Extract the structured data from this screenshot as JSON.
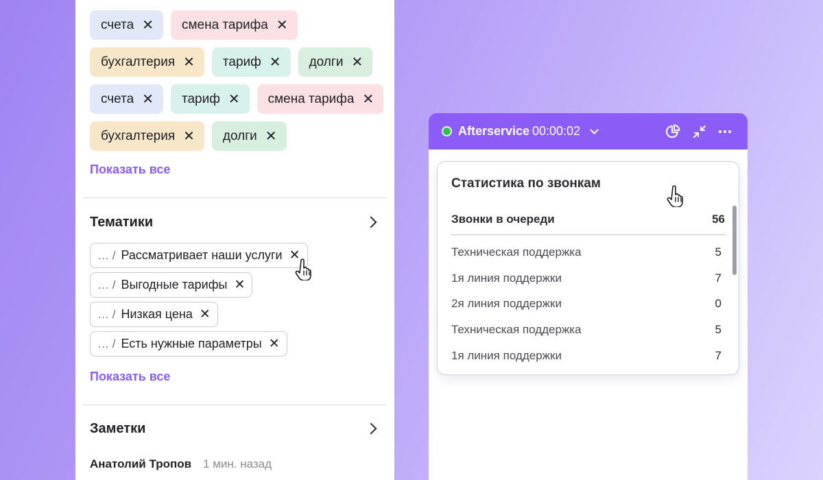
{
  "tags": {
    "rows": [
      [
        {
          "label": "счета",
          "color": "#e1e9f8"
        },
        {
          "label": "смена тарифа",
          "color": "#fbe1e4"
        }
      ],
      [
        {
          "label": "бухгалтерия",
          "color": "#f8e6c8"
        },
        {
          "label": "тариф",
          "color": "#d8f1ec"
        },
        {
          "label": "долги",
          "color": "#d8efdf"
        }
      ],
      [
        {
          "label": "счета",
          "color": "#e1e9f8"
        },
        {
          "label": "тариф",
          "color": "#d8f1ec"
        },
        {
          "label": "смена тарифа",
          "color": "#fbe1e4"
        }
      ],
      [
        {
          "label": "бухгалтерия",
          "color": "#f8e6c8"
        },
        {
          "label": "долги",
          "color": "#d8efdf"
        }
      ]
    ],
    "remove_glyph": "✕",
    "show_all": "Показать все"
  },
  "topics": {
    "title": "Тематики",
    "path_prefix": "… /",
    "items": [
      "Рассматривает наши услуги",
      "Выгодные тарифы",
      "Низкая цена",
      "Есть нужные параметры"
    ],
    "show_all": "Показать все"
  },
  "notes": {
    "title": "Заметки",
    "author": "Анатолий Тропов",
    "time": "1 мин. назад"
  },
  "widget": {
    "status_color": "#2fbf5a",
    "header_color": "#8b5cf6",
    "name": "Afterservice",
    "timer": "00:00:02",
    "icons": [
      "pie-chart-icon",
      "collapse-icon",
      "more-icon"
    ],
    "stats": {
      "title": "Статистика по звонкам",
      "queue_label": "Звонки в очереди",
      "queue_value": "56",
      "rows": [
        {
          "label": "Техническая поддержка",
          "value": "5"
        },
        {
          "label": "1я линия поддержки",
          "value": "7"
        },
        {
          "label": "2я линия поддержки",
          "value": "0"
        },
        {
          "label": "Техническая поддержка",
          "value": "5"
        },
        {
          "label": "1я линия поддержки",
          "value": "7"
        }
      ]
    }
  },
  "accent_color": "#8a5cf0"
}
